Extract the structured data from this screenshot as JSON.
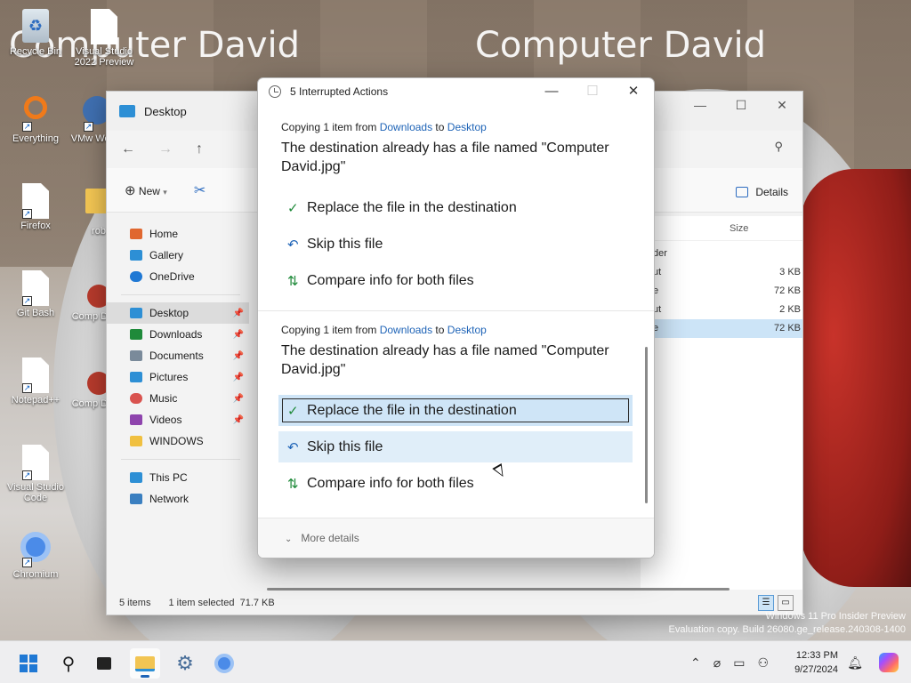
{
  "desktop": {
    "watermarks": [
      "Computer David",
      "Computer David"
    ],
    "icons": [
      {
        "label": "Recycle Bin",
        "icon": "recycle-bin-icon"
      },
      {
        "label": "Visual Studio 2022 Preview",
        "icon": "document-icon"
      },
      {
        "label": "Everything",
        "icon": "magnifier-icon"
      },
      {
        "label": "VMw Works",
        "icon": "vmware-icon"
      },
      {
        "label": "Firefox",
        "icon": "document-icon"
      },
      {
        "label": "rob",
        "icon": "folder-icon"
      },
      {
        "label": "Git Bash",
        "icon": "document-icon"
      },
      {
        "label": "Comp David",
        "icon": "image-icon"
      },
      {
        "label": "Notepad++",
        "icon": "document-icon"
      },
      {
        "label": "Comp David",
        "icon": "image-icon"
      },
      {
        "label": "Visual Studio Code",
        "icon": "document-icon"
      },
      {
        "label": "Chromium",
        "icon": "chromium-icon"
      }
    ],
    "build_info": [
      "Windows 11 Pro Insider Preview",
      "Evaluation copy. Build 26080.ge_release.240308-1400"
    ]
  },
  "explorer": {
    "title": "Desktop",
    "window_controls": {
      "minimize": "—",
      "maximize": "☐",
      "close": "✕"
    },
    "nav": {
      "back": "←",
      "forward": "→",
      "up": "↑"
    },
    "commands": {
      "new": "New",
      "details": "Details"
    },
    "navpane": [
      {
        "label": "Home",
        "color": "#e0672f"
      },
      {
        "label": "Gallery",
        "color": "#2d8fd5"
      },
      {
        "label": "OneDrive",
        "color": "#1f78d4"
      }
    ],
    "quick_access": [
      {
        "label": "Desktop",
        "color": "#2d8fd5",
        "pinned": true,
        "selected": true
      },
      {
        "label": "Downloads",
        "color": "#1f8a3a",
        "pinned": true
      },
      {
        "label": "Documents",
        "color": "#7a8a9a",
        "pinned": true
      },
      {
        "label": "Pictures",
        "color": "#2d8fd5",
        "pinned": true
      },
      {
        "label": "Music",
        "color": "#d9534f",
        "pinned": true
      },
      {
        "label": "Videos",
        "color": "#8e44ad",
        "pinned": true
      },
      {
        "label": "WINDOWS",
        "color": "#f0c040",
        "pinned": false
      }
    ],
    "this_pc": [
      {
        "label": "This PC",
        "color": "#2d8fd5"
      },
      {
        "label": "Network",
        "color": "#3a7fc0"
      }
    ],
    "column_size": "Size",
    "files": [
      {
        "name": "der",
        "size": ""
      },
      {
        "name": "ut",
        "size": "3 KB"
      },
      {
        "name": "e",
        "size": "72 KB"
      },
      {
        "name": "ut",
        "size": "2 KB"
      },
      {
        "name": "e",
        "size": "72 KB",
        "selected": true
      }
    ],
    "status": {
      "items": "5 items",
      "selected": "1 item selected",
      "size": "71.7 KB"
    }
  },
  "dialog": {
    "title": "5 Interrupted Actions",
    "controls": {
      "minimize": "—",
      "maximize": "☐",
      "close": "✕"
    },
    "sections": [
      {
        "head_prefix": "Copying 1 item from ",
        "from": "Downloads",
        "to_word": " to ",
        "to": "Desktop",
        "message": "The destination already has a file named \"Computer David.jpg\"",
        "options": [
          {
            "label": "Replace the file in the destination",
            "icon": "✓"
          },
          {
            "label": "Skip this file",
            "icon": "↶"
          },
          {
            "label": "Compare info for both files",
            "icon": "⇅"
          }
        ]
      },
      {
        "head_prefix": "Copying 1 item from ",
        "from": "Downloads",
        "to_word": " to ",
        "to": "Desktop",
        "message": "The destination already has a file named \"Computer David.jpg\"",
        "options": [
          {
            "label": "Replace the file in the destination",
            "icon": "✓"
          },
          {
            "label": "Skip this file",
            "icon": "↶"
          },
          {
            "label": "Compare info for both files",
            "icon": "⇅"
          }
        ]
      }
    ],
    "more_details": "More details"
  },
  "taskbar": {
    "clock_time": "12:33 PM",
    "clock_date": "9/27/2024",
    "tray_icons": [
      "chevron-up-icon",
      "network-icon",
      "display-icon",
      "settings-status-icon",
      "notification-bell-icon",
      "copilot-icon"
    ]
  }
}
